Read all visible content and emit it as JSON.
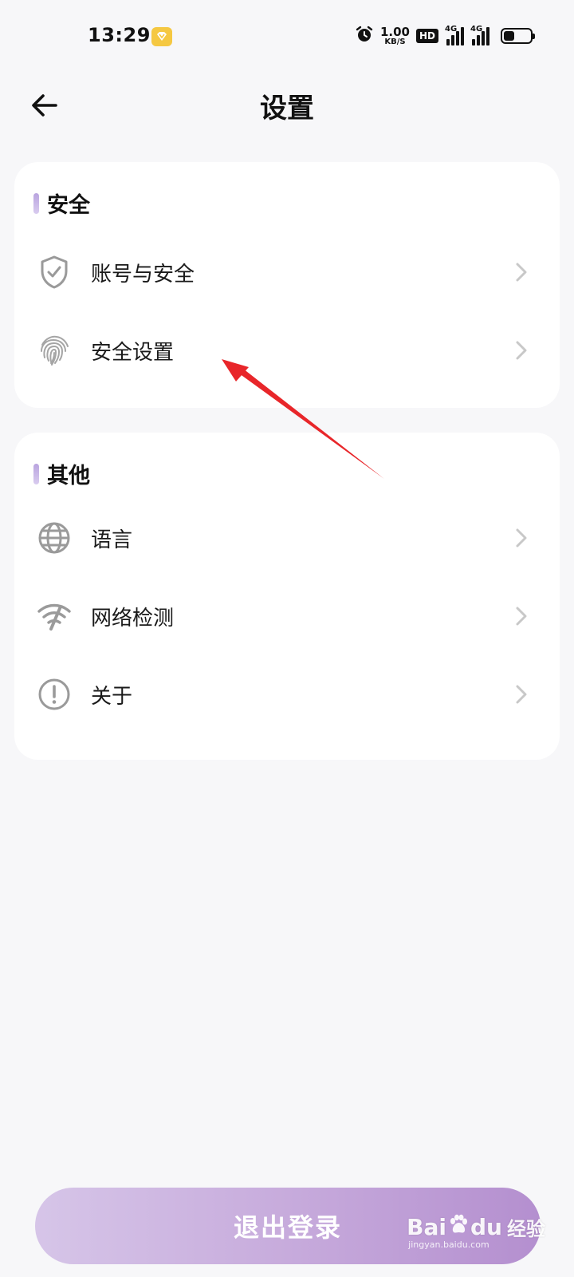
{
  "status_bar": {
    "time": "13:29",
    "net_speed_value": "1.00",
    "net_speed_unit": "KB/S",
    "hd_badge": "HD",
    "sim1": "4G",
    "sim2": "4G",
    "battery_level": 0.4
  },
  "header": {
    "title": "设置"
  },
  "sections": {
    "security": {
      "title": "安全",
      "items": [
        {
          "label": "账号与安全",
          "icon": "shield-check-icon"
        },
        {
          "label": "安全设置",
          "icon": "fingerprint-icon"
        }
      ]
    },
    "other": {
      "title": "其他",
      "items": [
        {
          "label": "语言",
          "icon": "globe-icon"
        },
        {
          "label": "网络检测",
          "icon": "wifi-signal-icon"
        },
        {
          "label": "关于",
          "icon": "info-exclamation-icon"
        }
      ]
    }
  },
  "logout": {
    "label": "退出登录"
  },
  "watermark": {
    "brand": "Bai",
    "brand_suffix": "du",
    "product": "经验",
    "url": "jingyan.baidu.com"
  },
  "colors": {
    "background": "#f7f7f9",
    "card": "#ffffff",
    "accent": "#b9a4df",
    "logout_start": "#d6c5e8",
    "logout_end": "#b48fcf",
    "arrow": "#e8262a",
    "icon_gray": "#9a9a9a",
    "chevron_gray": "#c8c8c8"
  }
}
